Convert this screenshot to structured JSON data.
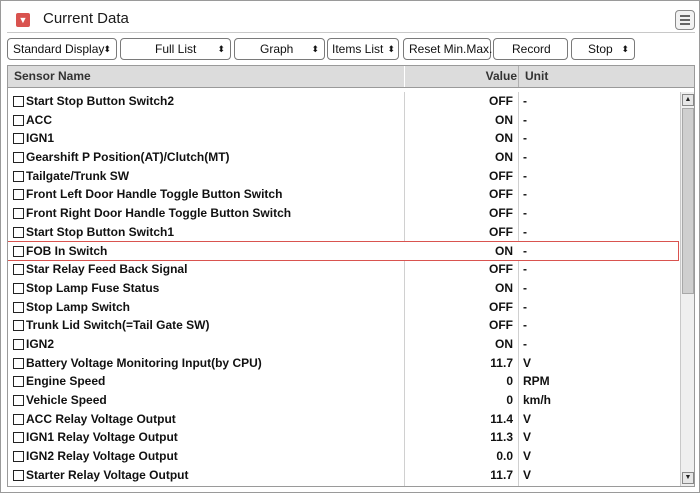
{
  "header": {
    "title": "Current Data",
    "collapse_icon": "chevron-down-icon",
    "menu_icon": "list-menu-icon"
  },
  "toolbar": {
    "standard_display": "Standard Display",
    "full_list": "Full List",
    "graph": "Graph",
    "items_list": "Items List",
    "reset_min_max": "Reset Min.Max.",
    "record": "Record",
    "stop": "Stop"
  },
  "table": {
    "columns": {
      "name": "Sensor Name",
      "value": "Value",
      "unit": "Unit"
    },
    "rows": [
      {
        "name": "Start Stop Button Switch2",
        "value": "OFF",
        "unit": "-"
      },
      {
        "name": "ACC",
        "value": "ON",
        "unit": "-"
      },
      {
        "name": "IGN1",
        "value": "ON",
        "unit": "-"
      },
      {
        "name": "Gearshift P Position(AT)/Clutch(MT)",
        "value": "ON",
        "unit": "-"
      },
      {
        "name": "Tailgate/Trunk SW",
        "value": "OFF",
        "unit": "-"
      },
      {
        "name": "Front Left Door Handle Toggle Button Switch",
        "value": "OFF",
        "unit": "-"
      },
      {
        "name": "Front Right Door Handle Toggle Button Switch",
        "value": "OFF",
        "unit": "-"
      },
      {
        "name": "Start Stop Button Switch1",
        "value": "OFF",
        "unit": "-"
      },
      {
        "name": "FOB In Switch",
        "value": "ON",
        "unit": "-",
        "selected": true
      },
      {
        "name": "Star Relay Feed Back Signal",
        "value": "OFF",
        "unit": "-"
      },
      {
        "name": "Stop Lamp Fuse Status",
        "value": "ON",
        "unit": "-"
      },
      {
        "name": "Stop Lamp Switch",
        "value": "OFF",
        "unit": "-"
      },
      {
        "name": "Trunk Lid Switch(=Tail Gate SW)",
        "value": "OFF",
        "unit": "-"
      },
      {
        "name": "IGN2",
        "value": "ON",
        "unit": "-"
      },
      {
        "name": "Battery Voltage Monitoring Input(by CPU)",
        "value": "11.7",
        "unit": "V"
      },
      {
        "name": "Engine Speed",
        "value": "0",
        "unit": "RPM"
      },
      {
        "name": "Vehicle Speed",
        "value": "0",
        "unit": "km/h"
      },
      {
        "name": "ACC Relay Voltage Output",
        "value": "11.4",
        "unit": "V"
      },
      {
        "name": "IGN1 Relay Voltage Output",
        "value": "11.3",
        "unit": "V"
      },
      {
        "name": "IGN2 Relay Voltage Output",
        "value": "0.0",
        "unit": "V"
      },
      {
        "name": "Starter Relay Voltage Output",
        "value": "11.7",
        "unit": "V"
      }
    ]
  },
  "colors": {
    "accent": "#d9534f",
    "header_bg": "#dcdcdc",
    "selection_border": "#d9534f"
  }
}
